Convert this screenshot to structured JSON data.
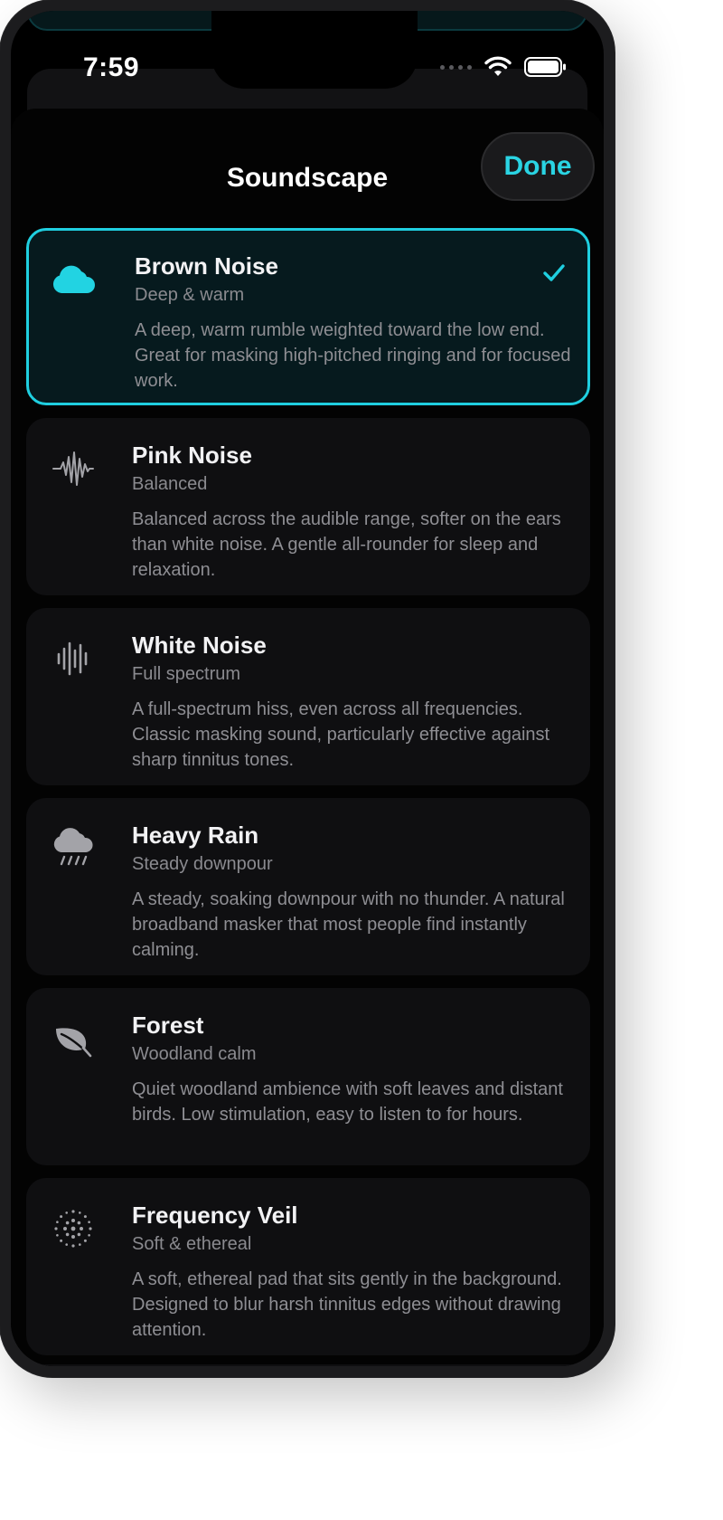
{
  "status_bar": {
    "time": "7:59",
    "icons": [
      "cellular-signal-icon",
      "wifi-icon",
      "battery-icon"
    ]
  },
  "header": {
    "title": "Soundscape",
    "done_label": "Done"
  },
  "colors": {
    "accent": "#1fcfe0",
    "background": "#000000",
    "card": "#0f0f11",
    "selected_card": "#061a1e"
  },
  "soundscapes": [
    {
      "name": "Brown Noise",
      "subtitle": "Deep & warm",
      "description": "A deep, warm rumble weighted toward the low end. Great for masking high-pitched ringing and for focused work.",
      "icon": "cloud-icon",
      "selected": true
    },
    {
      "name": "Pink Noise",
      "subtitle": "Balanced",
      "description": "Balanced across the audible range, softer on the ears than white noise. A gentle all-rounder for sleep and relaxation.",
      "icon": "waveform-icon",
      "selected": false
    },
    {
      "name": "White Noise",
      "subtitle": "Full spectrum",
      "description": "A full-spectrum hiss, even across all frequencies. Classic masking sound, particularly effective against sharp tinnitus tones.",
      "icon": "audio-bars-icon",
      "selected": false
    },
    {
      "name": "Heavy Rain",
      "subtitle": "Steady downpour",
      "description": "A steady, soaking downpour with no thunder. A natural broadband masker that most people find instantly calming.",
      "icon": "rain-cloud-icon",
      "selected": false
    },
    {
      "name": "Forest",
      "subtitle": "Woodland calm",
      "description": "Quiet woodland ambience with soft leaves and distant birds. Low stimulation, easy to listen to for hours.",
      "icon": "leaf-icon",
      "selected": false
    },
    {
      "name": "Frequency Veil",
      "subtitle": "Soft & ethereal",
      "description": "A soft, ethereal pad that sits gently in the background. Designed to blur harsh tinnitus edges without drawing attention.",
      "icon": "dotted-circle-icon",
      "selected": false
    }
  ]
}
